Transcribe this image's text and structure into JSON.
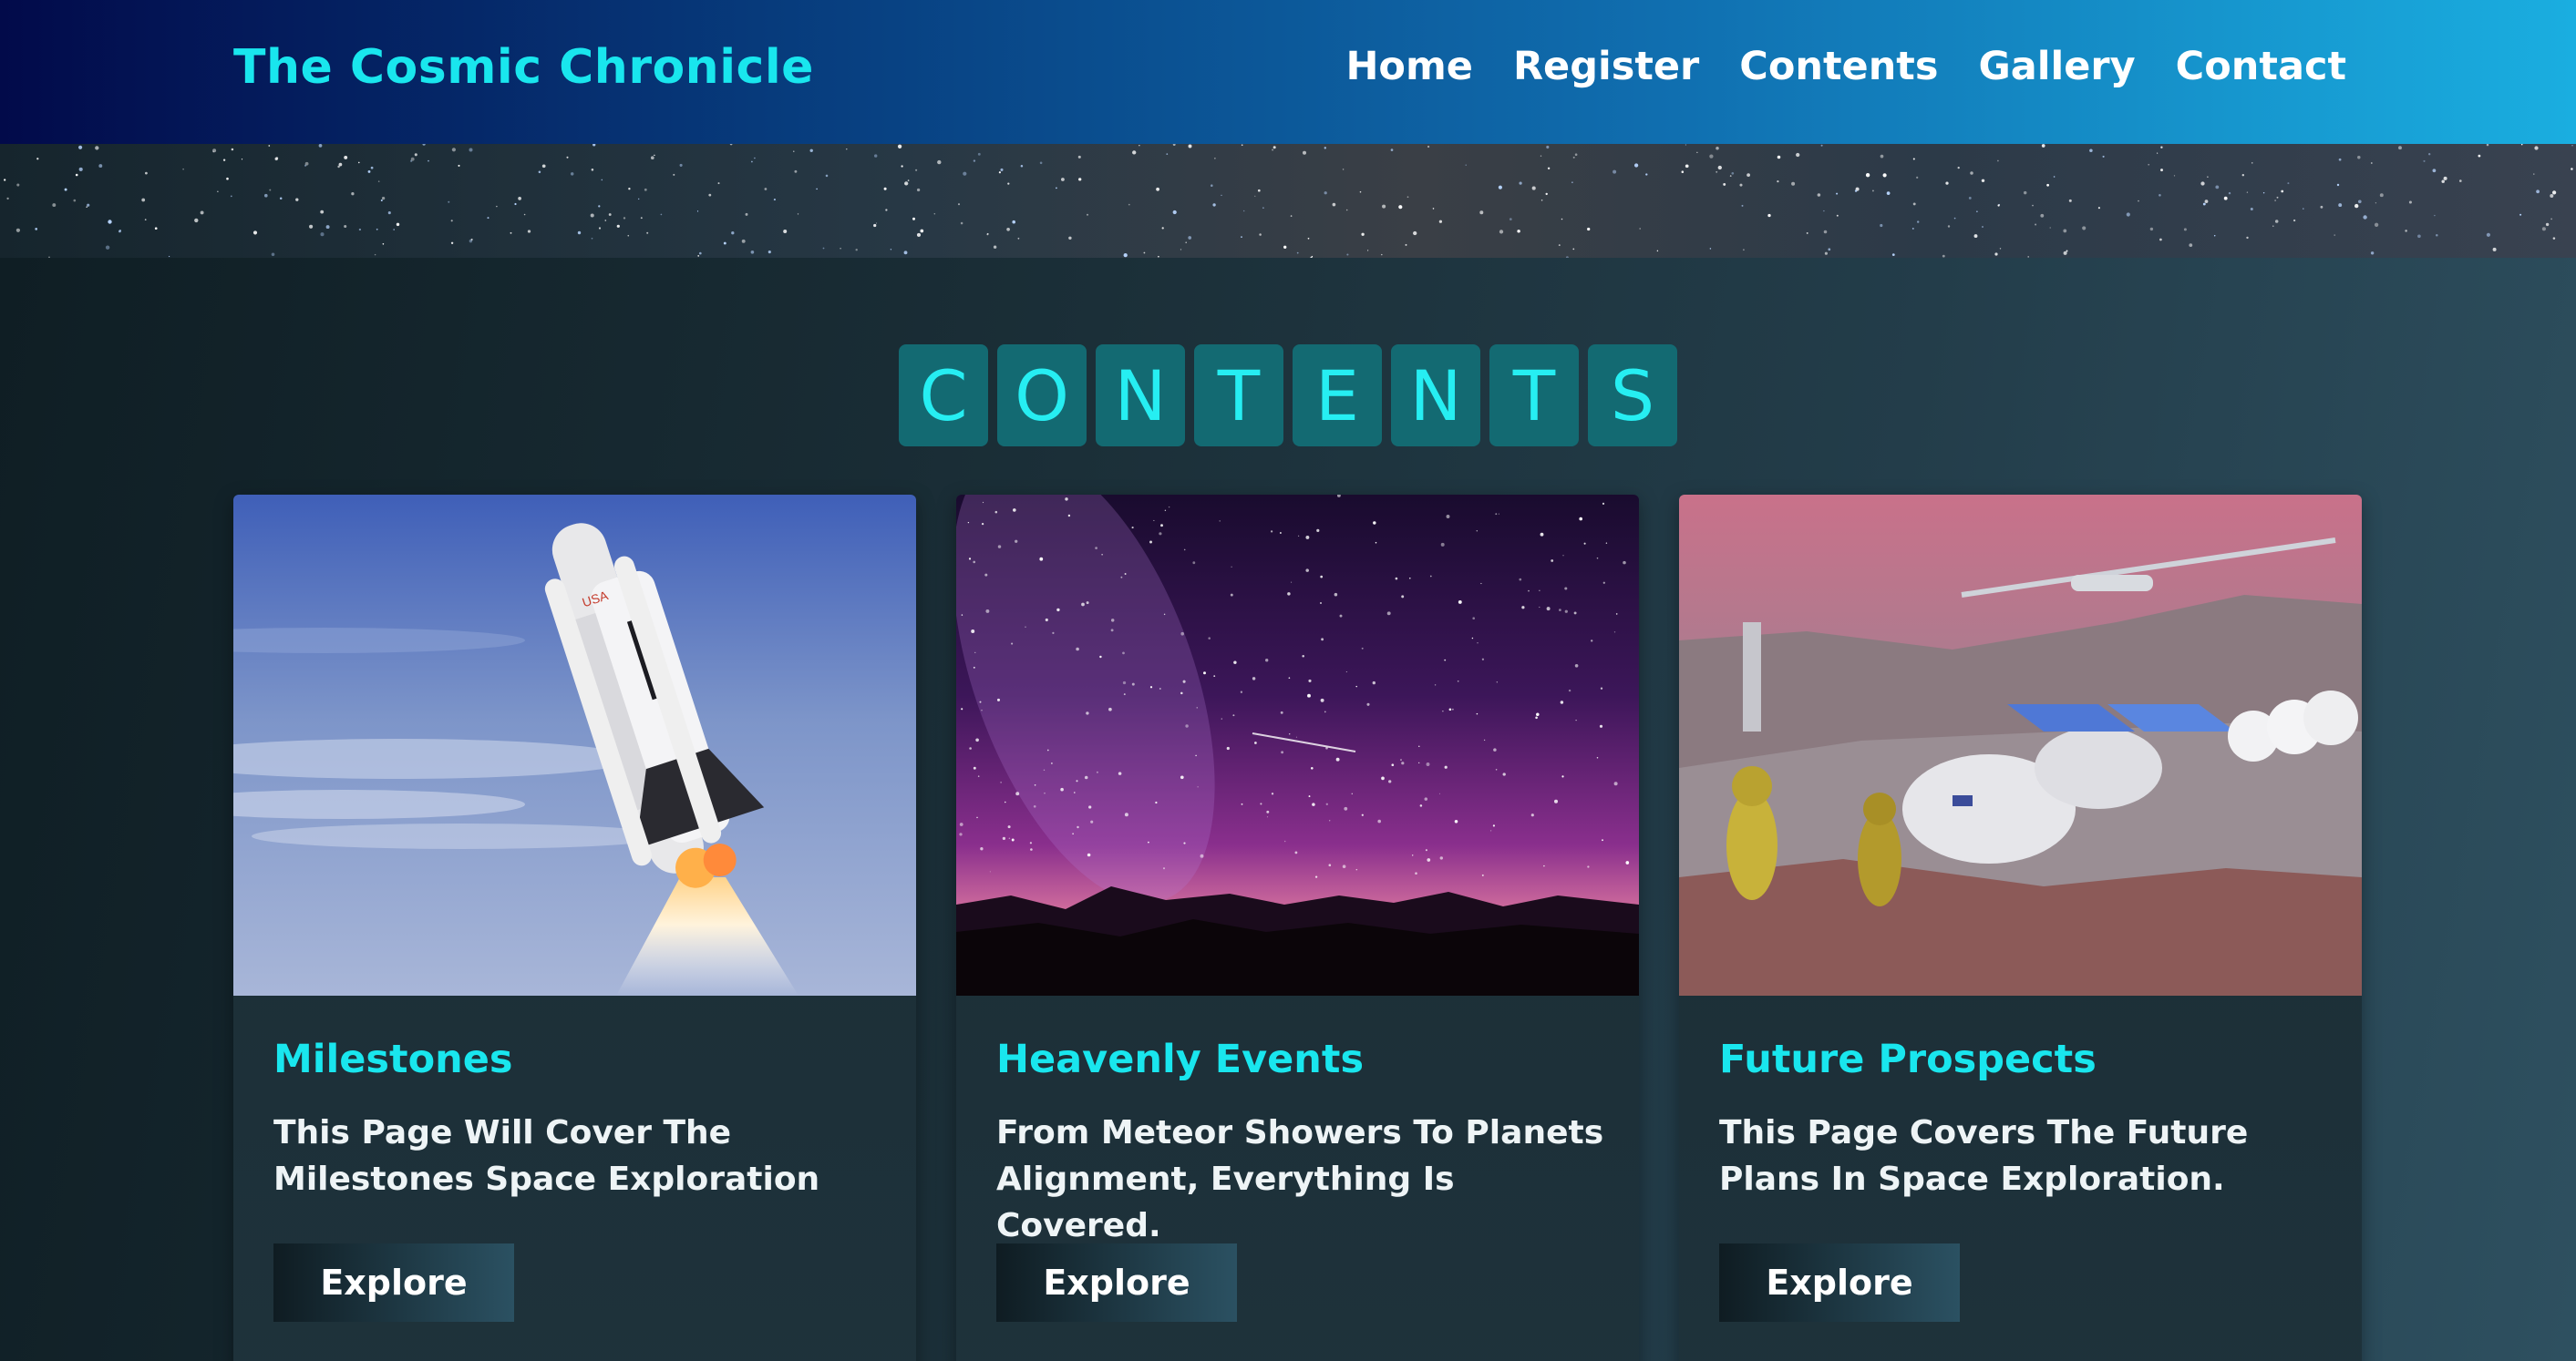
{
  "header": {
    "brand": "The Cosmic Chronicle",
    "nav": [
      "Home",
      "Register",
      "Contents",
      "Gallery",
      "Contact"
    ]
  },
  "section": {
    "title_letters": [
      "C",
      "O",
      "N",
      "T",
      "E",
      "N",
      "T",
      "S"
    ]
  },
  "cards": [
    {
      "title": "Milestones",
      "description": "This Page Will Cover The Milestones Space Exploration",
      "button": "Explore",
      "image": "space-shuttle-launch-image"
    },
    {
      "title": "Heavenly Events",
      "description": "From Meteor Showers To Planets Alignment, Everything Is Covered.",
      "button": "Explore",
      "image": "milky-way-night-sky-image"
    },
    {
      "title": "Future Prospects",
      "description": "This Page Covers The Future Plans In Space Exploration.",
      "button": "Explore",
      "image": "mars-colony-illustration-image"
    }
  ],
  "colors": {
    "accent": "#19e6ee",
    "header_start": "#020a4a",
    "header_end": "#1aaee0",
    "letter_tile": "#136a72"
  }
}
